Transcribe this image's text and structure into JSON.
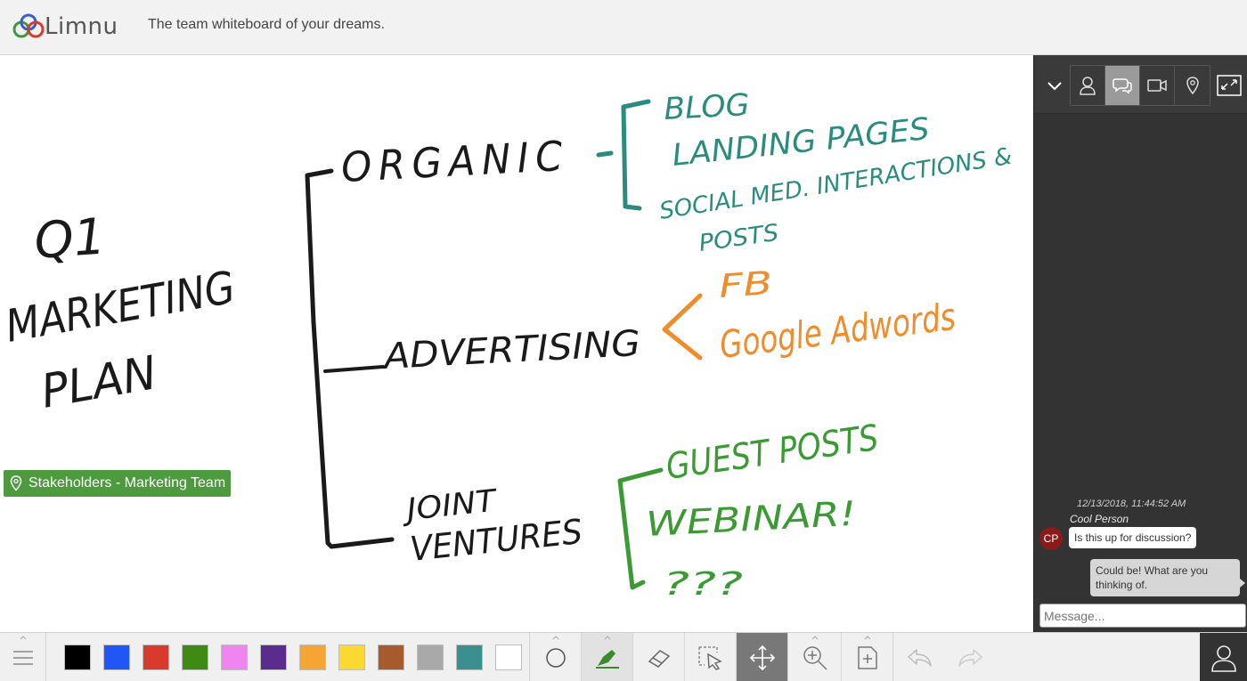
{
  "app": {
    "name": "Limnu",
    "tagline": "The team whiteboard of your dreams."
  },
  "board": {
    "ink": {
      "title_lines": [
        "Q1",
        "MARKETING",
        "PLAN"
      ],
      "branches": [
        "ORGANIC",
        "ADVERTISING",
        "JOINT",
        "VENTURES"
      ],
      "organic_items": [
        "BLOG",
        "LANDING PAGES",
        "SOCIAL MED. INTERACTIONS &",
        "POSTS"
      ],
      "advertising_items": [
        "FB",
        "Google Adwords"
      ],
      "joint_items": [
        "GUEST POSTS",
        "WEBINAR!",
        "???"
      ],
      "ink_colors": {
        "black": "#1a1a1a",
        "teal": "#2a8c7e",
        "orange": "#f08c2a",
        "green": "#3c9a35"
      }
    },
    "location_tag": {
      "label": "Stakeholders - Marketing Team",
      "icon": "map-pin-icon",
      "color": "#4e9a3f"
    }
  },
  "side_panel": {
    "tabs": [
      {
        "icon": "user-icon",
        "active": false
      },
      {
        "icon": "chat-icon",
        "active": true
      },
      {
        "icon": "video-icon",
        "active": false
      },
      {
        "icon": "map-pin-icon",
        "active": false
      }
    ],
    "chat": {
      "timestamp": "12/13/2018, 11:44:52 AM",
      "sender": "Cool Person",
      "avatar_initials": "CP",
      "messages": [
        {
          "from": "other",
          "text": "Is this up for discussion?"
        },
        {
          "from": "me",
          "text": "Could be! What are you thinking of."
        }
      ],
      "input_placeholder": "Message..."
    }
  },
  "toolbar": {
    "colors": [
      "#000000",
      "#2255f5",
      "#d83a2e",
      "#3f8a14",
      "#f084f0",
      "#5b2b8e",
      "#f4a534",
      "#fbd930",
      "#a75a2e",
      "#a9a9a9",
      "#3b8f8f",
      "#ffffff"
    ],
    "tools": [
      "menu-icon",
      "circle-shape-icon",
      "marker-icon",
      "eraser-icon",
      "select-icon",
      "move-icon",
      "zoom-in-icon",
      "add-page-icon",
      "undo-icon",
      "redo-icon",
      "user-icon"
    ]
  }
}
